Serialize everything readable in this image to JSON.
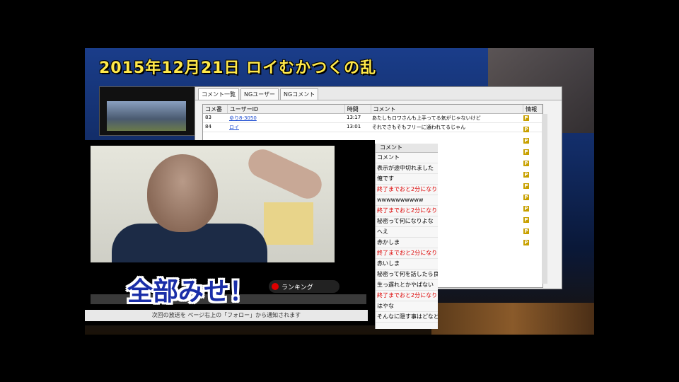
{
  "overlay_title": "2015年12月21日 ロイむかつくの乱",
  "caption": "全部みせ！",
  "notification": "次回の放送を ページ右上の「フォロー」から通知されます",
  "ranking_label": "ランキング",
  "comment_window": {
    "tabs": [
      "コメント一覧",
      "NGユーザー",
      "NGコメント"
    ],
    "columns": [
      "コメ番",
      "ユーザーID",
      "時間",
      "コメント",
      "情報"
    ],
    "rows": [
      {
        "no": "83",
        "user": "ゆり8-3050",
        "time": "13:17",
        "text": "あたしもロワさんも上手ってる気がじゃないけど"
      },
      {
        "no": "84",
        "user": "ロイ",
        "time": "13:01",
        "text": "それでさもそもフリーに通われてるじゃん"
      }
    ]
  },
  "comment_strip": {
    "header": "コメント",
    "rows": [
      {
        "text": "コメント",
        "red": false
      },
      {
        "text": "表示が途中切れました",
        "red": false
      },
      {
        "text": "俺です",
        "red": false
      },
      {
        "text": "終了までおと2分になり",
        "red": true
      },
      {
        "text": "wwwwwwwwww",
        "red": false
      },
      {
        "text": "終了までおと2分になり",
        "red": true
      },
      {
        "text": "秘密って何になりよな",
        "red": false
      },
      {
        "text": "へえ",
        "red": false
      },
      {
        "text": "赤かしま",
        "red": false
      },
      {
        "text": "終了までおと2分になり",
        "red": true
      },
      {
        "text": "赤いしま",
        "red": false
      },
      {
        "text": "秘密って何を話したら良",
        "red": false
      },
      {
        "text": "生っ遅れとかやばない",
        "red": false
      },
      {
        "text": "終了までおと2分になり",
        "red": true
      },
      {
        "text": "はやな",
        "red": false
      },
      {
        "text": "そんなに隠す事はどなど",
        "red": false
      }
    ]
  },
  "colors": {
    "title": "#ffe94a",
    "caption": "#1a2ea8",
    "alert_text": "#dd0000",
    "premium_mark": "#c8a000"
  }
}
